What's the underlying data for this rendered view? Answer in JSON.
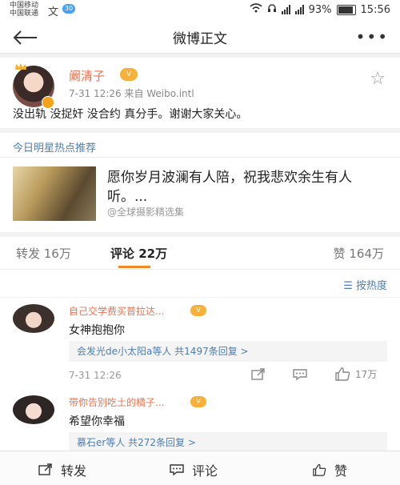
{
  "status_bar": {
    "carrier_1": "中国移动",
    "carrier_2": "中国联通",
    "badge": "30",
    "battery": "93%",
    "time": "15:56"
  },
  "nav": {
    "title": "微博正文",
    "more": "•••"
  },
  "post": {
    "username": "阚清子",
    "vip_badge": "V",
    "meta": "7-31 12:26  来自 Weibo.intl",
    "text": "没出轨 没捉奸 没合约 真分手。谢谢大家关心。"
  },
  "hot": {
    "title": "今日明星热点推荐",
    "headline": "愿你岁月波澜有人陪，祝我悲欢余生有人听。...",
    "source": "@全球摄影精选集"
  },
  "tabs": {
    "repost": "转发 16万",
    "comment": "评论 22万",
    "like": "赞 164万"
  },
  "sort": {
    "label": "按热度"
  },
  "comments": [
    {
      "name": "自己交学费买普拉达...",
      "text": "女神抱抱你",
      "replies": "会发光de小太阳a等人  共1497条回复 >",
      "time": "7-31 12:26",
      "likes": "17万"
    },
    {
      "name": "带你告别吃土的橘子...",
      "text": "希望你幸福",
      "replies": "慕石er等人  共272条回复 >"
    }
  ],
  "bottom_bar": {
    "repost": "转发",
    "comment": "评论",
    "like": "赞"
  }
}
